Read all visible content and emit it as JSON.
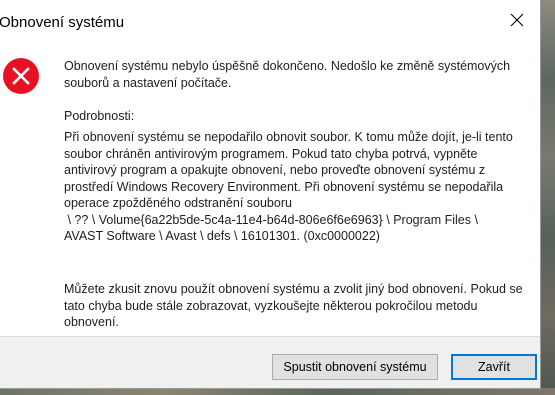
{
  "window": {
    "title": "Obnovení systému"
  },
  "icons": {
    "error": "error-icon",
    "close": "close-icon"
  },
  "message": {
    "main": "Obnovení systému nebylo úspěšně dokončeno. Nedošlo ke změně systémových souborů a nastavení počítače.",
    "details_label": "Podrobnosti:",
    "details_lines": [
      "Při obnovení systému se nepodařilo obnovit soubor. K tomu může dojít, je-li tento",
      "soubor chráněn antivirovým programem. Pokud tato chyba potrvá, vypněte",
      "antivirový program a opakujte obnovení, nebo proveďte obnovení systému z",
      "prostředí Windows Recovery Environment. Při obnovení systému se nepodařila",
      "operace zpožděného odstranění souboru",
      " \\ ?? \\ Volume{6a22b5de-5c4a-11e4-b64d-806e6f6e6963} \\ Program Files \\",
      "AVAST Software \\ Avast \\ defs \\ 16101301. (0xc0000022)"
    ],
    "suggestion_lines": [
      "Můžete zkusit znovu použít obnovení systému a zvolit jiný bod obnovení. Pokud se",
      "tato chyba bude stále zobrazovat, vyzkoušejte některou pokročilou metodu",
      "obnovení."
    ]
  },
  "buttons": {
    "restore": "Spustit obnovení systému",
    "close": "Zavřít"
  },
  "colors": {
    "error_red": "#e81123",
    "accent_blue": "#0078d7",
    "footer_bg": "#f0f0f0"
  }
}
